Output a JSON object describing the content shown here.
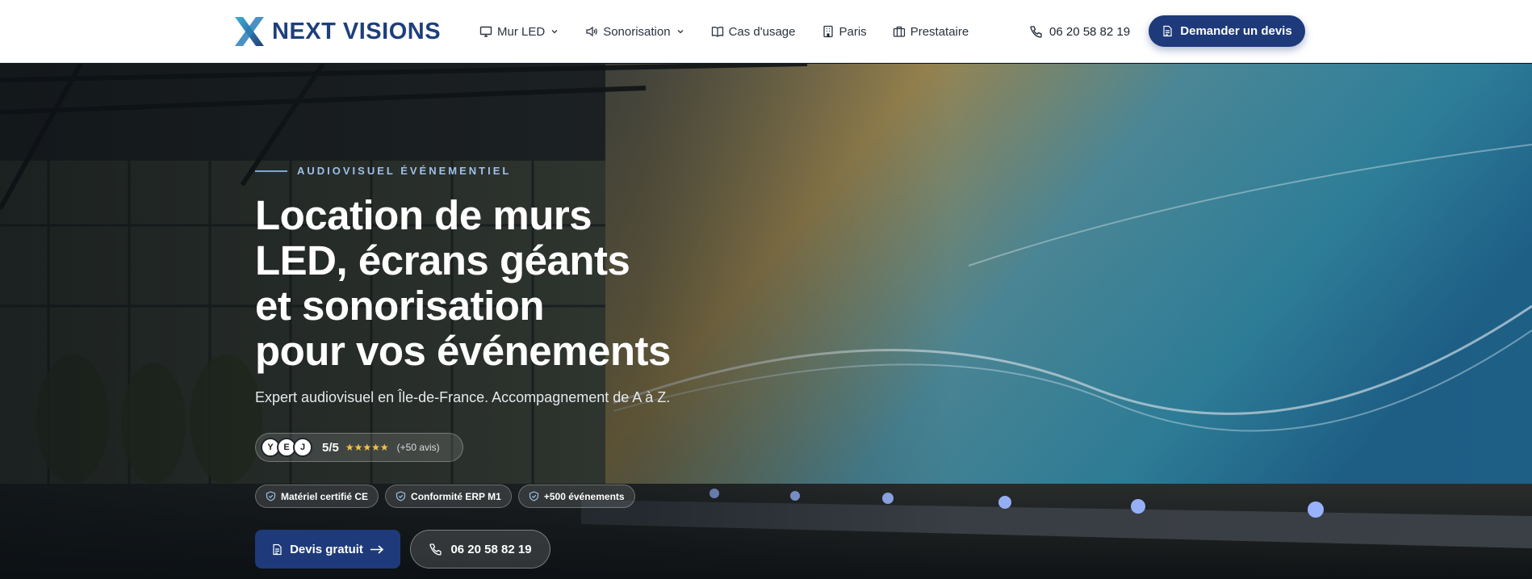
{
  "header": {
    "logo_text": "NEXT VISIONS",
    "nav": [
      {
        "label": "Mur LED",
        "icon": "monitor-icon",
        "has_dropdown": true
      },
      {
        "label": "Sonorisation",
        "icon": "speaker-icon",
        "has_dropdown": true
      },
      {
        "label": "Cas d'usage",
        "icon": "book-icon",
        "has_dropdown": false
      },
      {
        "label": "Paris",
        "icon": "building-icon",
        "has_dropdown": false
      },
      {
        "label": "Prestataire",
        "icon": "briefcase-icon",
        "has_dropdown": false
      }
    ],
    "phone": "06 20 58 82 19",
    "cta_label": "Demander un devis"
  },
  "hero": {
    "eyebrow": "AUDIOVISUEL ÉVÉNEMENTIEL",
    "headline_lines": [
      "Location de murs",
      "LED, écrans géants",
      "et sonorisation",
      "pour vos événements"
    ],
    "subtitle": "Expert audiovisuel en Île-de-France. Accompagnement de A à Z.",
    "rating": {
      "avatars": [
        "Y",
        "E",
        "J"
      ],
      "score": "5/5",
      "stars": "★★★★★",
      "reviews": "(+50 avis)"
    },
    "badges": [
      "Matériel certifié CE",
      "Conformité ERP M1",
      "+500 événements"
    ],
    "primary_button": "Devis gratuit",
    "secondary_button": "06 20 58 82 19"
  },
  "colors": {
    "brand": "#1e3a7a",
    "eyebrow": "#9fc0e6",
    "stars": "#f3c440"
  }
}
